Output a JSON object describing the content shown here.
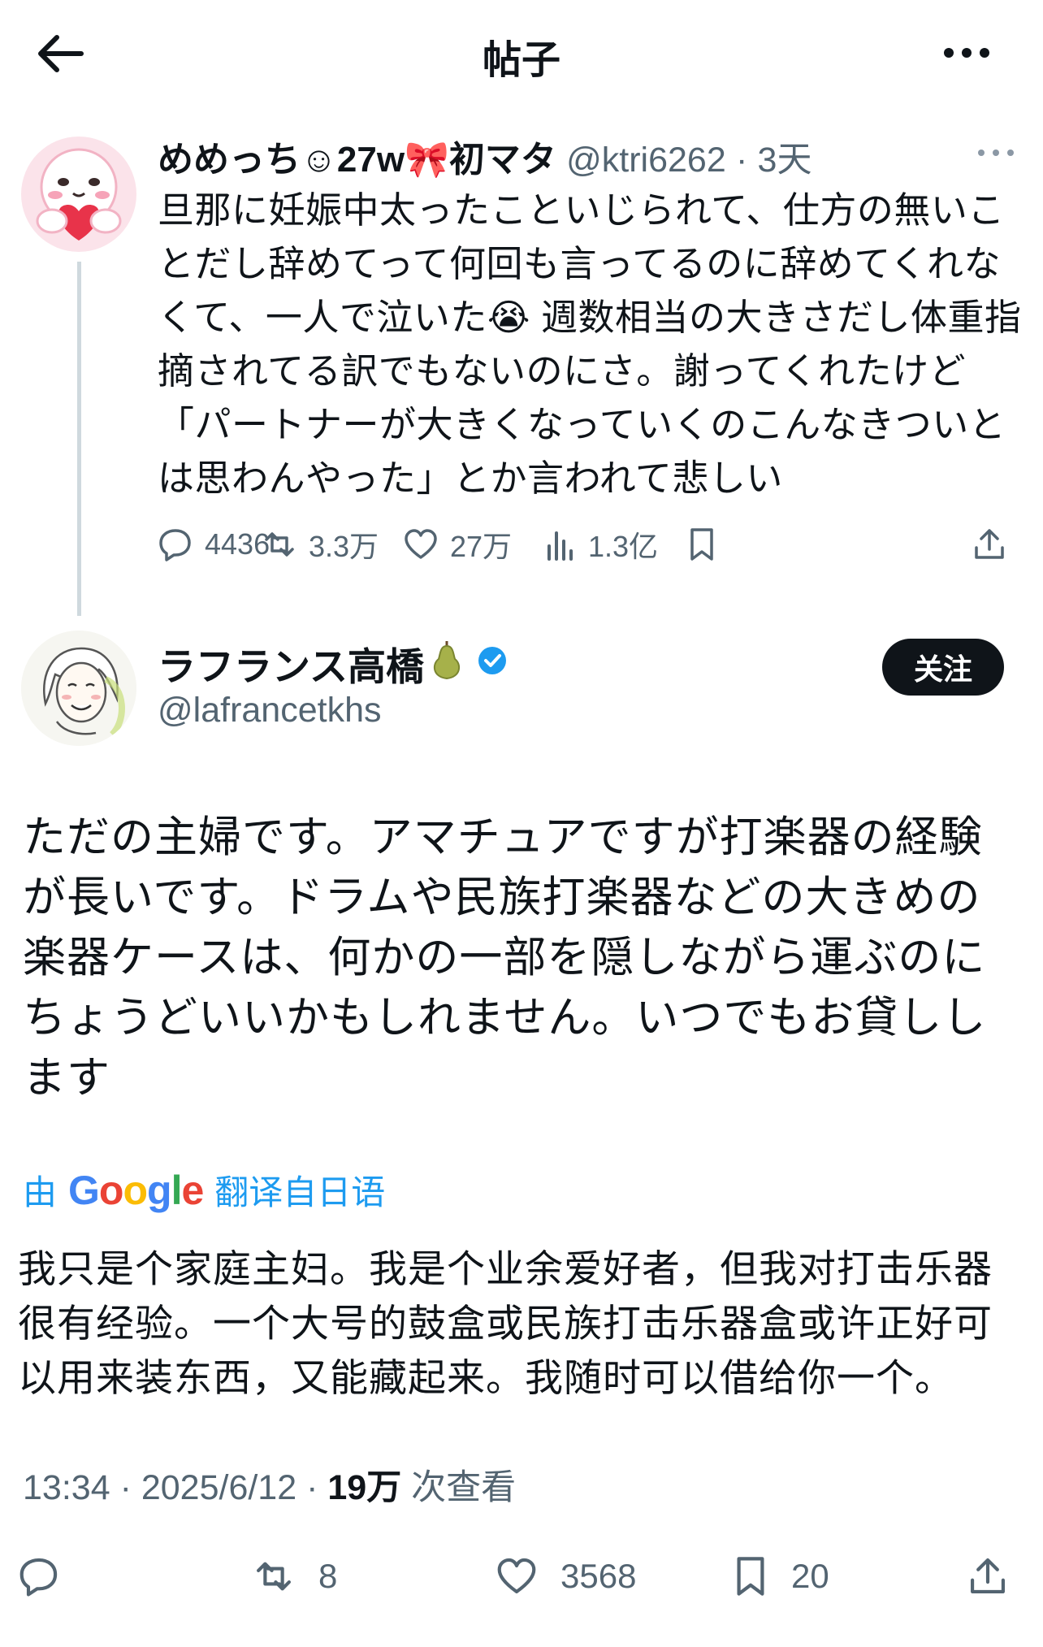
{
  "header": {
    "title": "帖子"
  },
  "parent": {
    "name": "めめっち☺27w🎀初マタ",
    "handle": "@ktri6262",
    "time": "3天",
    "text": "旦那に妊娠中太ったこといじられて、仕方の無いことだし辞めてって何回も言ってるのに辞めてくれなくて、一人で泣いた😭 週数相当の大きさだし体重指摘されてる訳でもないのにさ。謝ってくれたけど「パートナーが大きくなっていくのこんなきついとは思わんやった」とか言われて悲しい",
    "replies": "4436",
    "reposts": "3.3万",
    "likes": "27万",
    "views": "1.3亿"
  },
  "main": {
    "name": "ラフランス高橋",
    "handle": "@lafrancetkhs",
    "follow_label": "关注",
    "text": "ただの主婦です。アマチュアですが打楽器の経験が長いです。ドラムや民族打楽器などの大きめの楽器ケースは、何かの一部を隠しながら運ぶのにちょうどいいかもしれません。いつでもお貸しします",
    "translate": {
      "prefix": "由",
      "brand": "Google",
      "suffix": "翻译自日语"
    },
    "translation": "我只是个家庭主妇。我是个业余爱好者，但我对打击乐器很有经验。一个大号的鼓盒或民族打击乐器盒或许正好可以用来装东西，又能藏起来。我随时可以借给你一个。",
    "time": "13:34",
    "date": "2025/6/12",
    "views": "19万",
    "views_label": "次查看",
    "reposts": "8",
    "likes": "3568",
    "bookmarks": "20"
  },
  "colors": {
    "accent": "#1d9bf0",
    "muted": "#536471",
    "text": "#0f1419"
  }
}
